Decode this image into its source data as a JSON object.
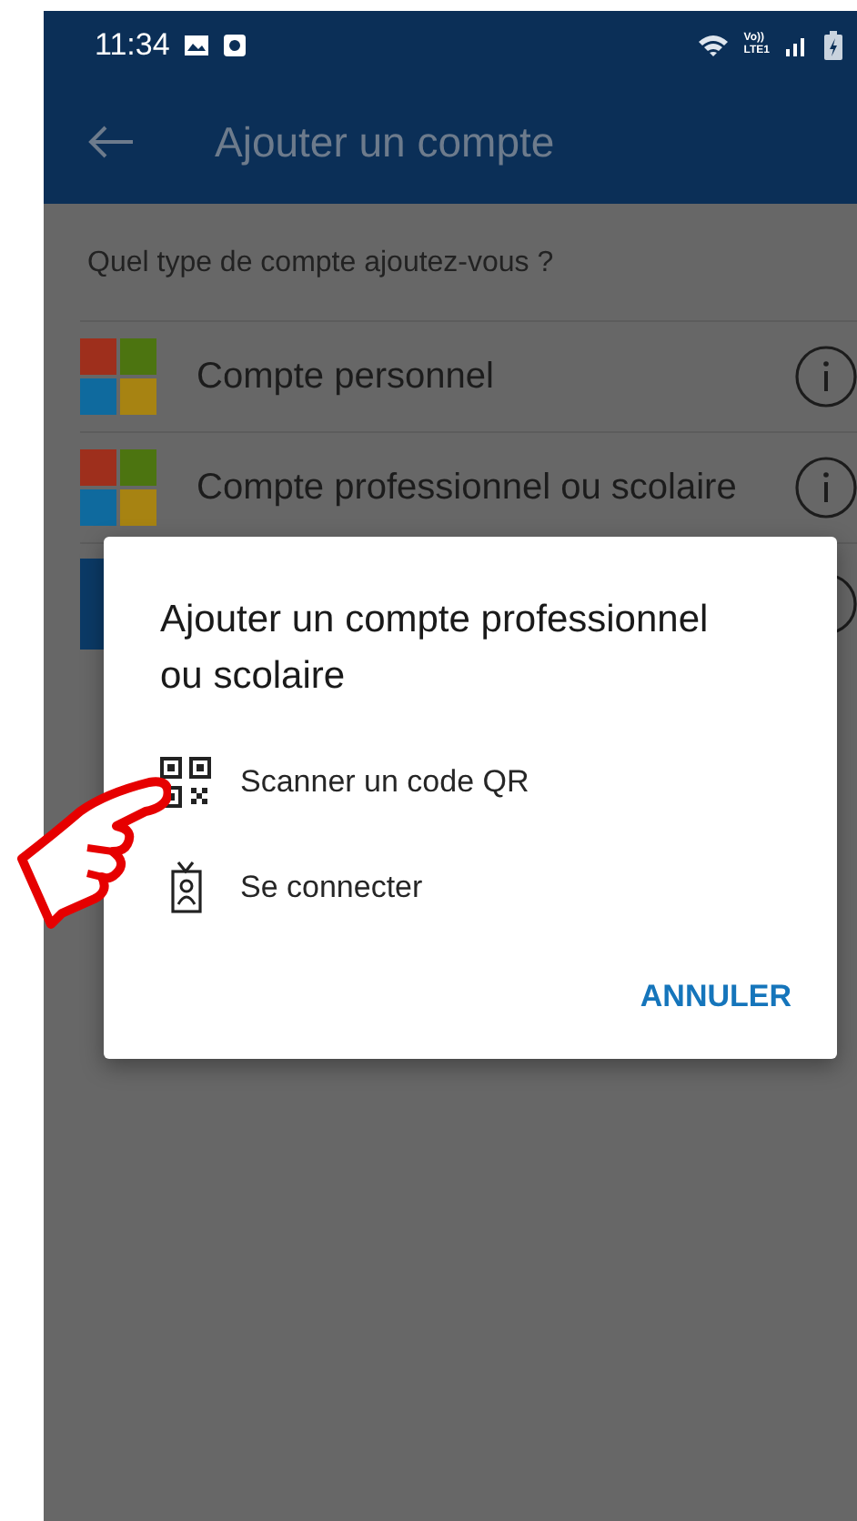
{
  "status_bar": {
    "time": "11:34",
    "network_top": "Vo))",
    "network_bottom": "LTE1"
  },
  "app_bar": {
    "title": "Ajouter un compte"
  },
  "prompt": "Quel type de compte ajoutez-vous ?",
  "accounts": [
    {
      "kind": "windows",
      "label": "Compte personnel"
    },
    {
      "kind": "windows",
      "label": "Compte professionnel ou scolaire"
    },
    {
      "kind": "other"
    }
  ],
  "dialog": {
    "title": "Ajouter un compte professionnel ou scolaire",
    "options": [
      {
        "kind": "qr",
        "label": "Scanner un code QR"
      },
      {
        "kind": "badge",
        "label": "Se connecter"
      }
    ],
    "cancel": "ANNULER"
  }
}
